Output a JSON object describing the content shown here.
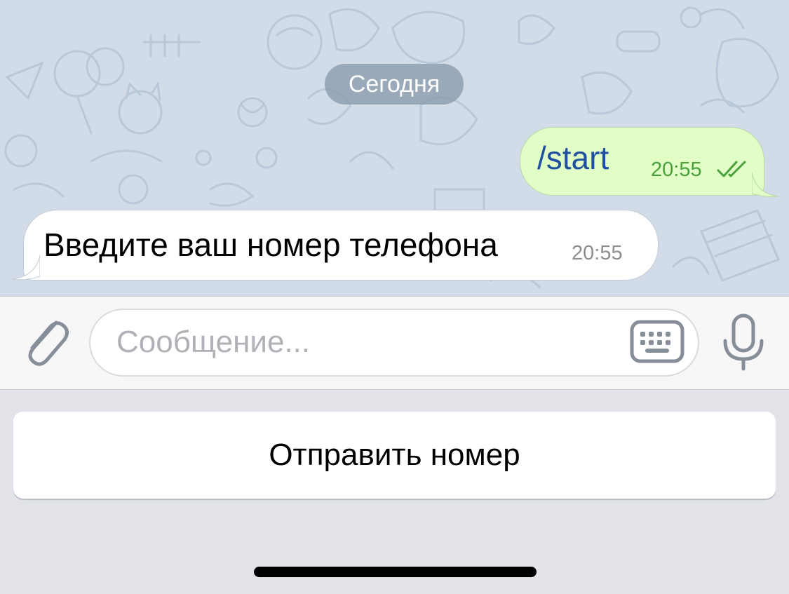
{
  "chat": {
    "date_divider": "Сегодня",
    "messages": [
      {
        "direction": "outgoing",
        "text": "/start",
        "time": "20:55",
        "status": "read"
      },
      {
        "direction": "incoming",
        "text": "Введите ваш номер телефона",
        "time": "20:55"
      }
    ]
  },
  "composer": {
    "placeholder": "Сообщение...",
    "value": "",
    "attach_icon": "paperclip-icon",
    "keyboard_icon": "keyboard-icon",
    "mic_icon": "microphone-icon"
  },
  "reply_keyboard": {
    "buttons": [
      "Отправить номер"
    ]
  },
  "colors": {
    "chat_background": "#d2dce8",
    "outgoing_bubble": "#e1fec6",
    "incoming_bubble": "#ffffff",
    "outgoing_text": "#1f4fa0",
    "outgoing_time": "#4aa03a"
  }
}
